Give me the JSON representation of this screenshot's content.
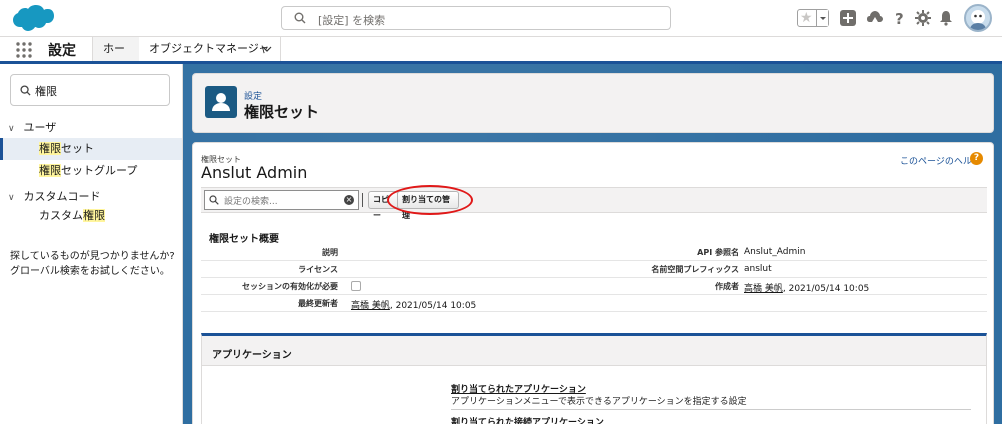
{
  "header": {
    "search_placeholder": "[設定] を検索",
    "icons": [
      "favorites-star-icon",
      "add-icon",
      "trailhead-icon",
      "help-icon",
      "setup-gear-icon",
      "notifications-bell-icon",
      "user-avatar"
    ]
  },
  "nav": {
    "app_name": "設定",
    "tabs": [
      {
        "label": "ホーム",
        "active": true
      },
      {
        "label": "オブジェクトマネージャ",
        "active": false
      }
    ]
  },
  "sidebar": {
    "quick_find_value": "権限",
    "groups": [
      {
        "label": "ユーザ",
        "items": [
          {
            "hl": "権限",
            "rest": "セット",
            "selected": true
          },
          {
            "hl": "権限",
            "rest": "セットグループ",
            "selected": false
          }
        ]
      },
      {
        "label": "カスタムコード",
        "items": [
          {
            "pre": "カスタム",
            "hl": "権限",
            "selected": false
          }
        ]
      }
    ],
    "not_found_text_1": "探しているものが見つかりませんか?",
    "not_found_text_2": "グローバル検索をお試しください。"
  },
  "page_header": {
    "eyebrow": "設定",
    "title": "権限セット"
  },
  "record": {
    "type_label": "権限セット",
    "name": "Anslut Admin",
    "help_link": "このページのヘルプ",
    "help_icon_glyph": "?"
  },
  "toolbar": {
    "search_placeholder": "設定の検索...",
    "copy_button": "コピー",
    "assign_button": "割り当ての管理"
  },
  "overview": {
    "title": "権限セット概要",
    "rows": [
      {
        "label1": "説明",
        "value1": "",
        "label2": "API 参照名",
        "value2": "Anslut_Admin"
      },
      {
        "label1": "ライセンス",
        "value1": "",
        "label2": "名前空間プレフィックス",
        "value2": "anslut"
      },
      {
        "label1": "セッションの有効化が必要",
        "value1_checkbox": false,
        "label2": "作成者",
        "value2_link": "高橋 美帆",
        "value2_rest": ", 2021/05/14 10:05"
      },
      {
        "label1": "最終更新者",
        "value1_link": "高橋 美帆",
        "value1_rest": ", 2021/05/14 10:05",
        "label2": "",
        "value2": ""
      }
    ]
  },
  "applications": {
    "title": "アプリケーション",
    "link1": "割り当てられたアプリケーション",
    "desc1": "アプリケーションメニューで表示できるアプリケーションを指定する設定",
    "link2": "割り当てられた接続アプリケーション"
  },
  "colors": {
    "brand_blue": "#1b5297",
    "page_bg": "#2f6ea1",
    "highlight": "#fff59d",
    "annotation_red": "#e01818"
  }
}
